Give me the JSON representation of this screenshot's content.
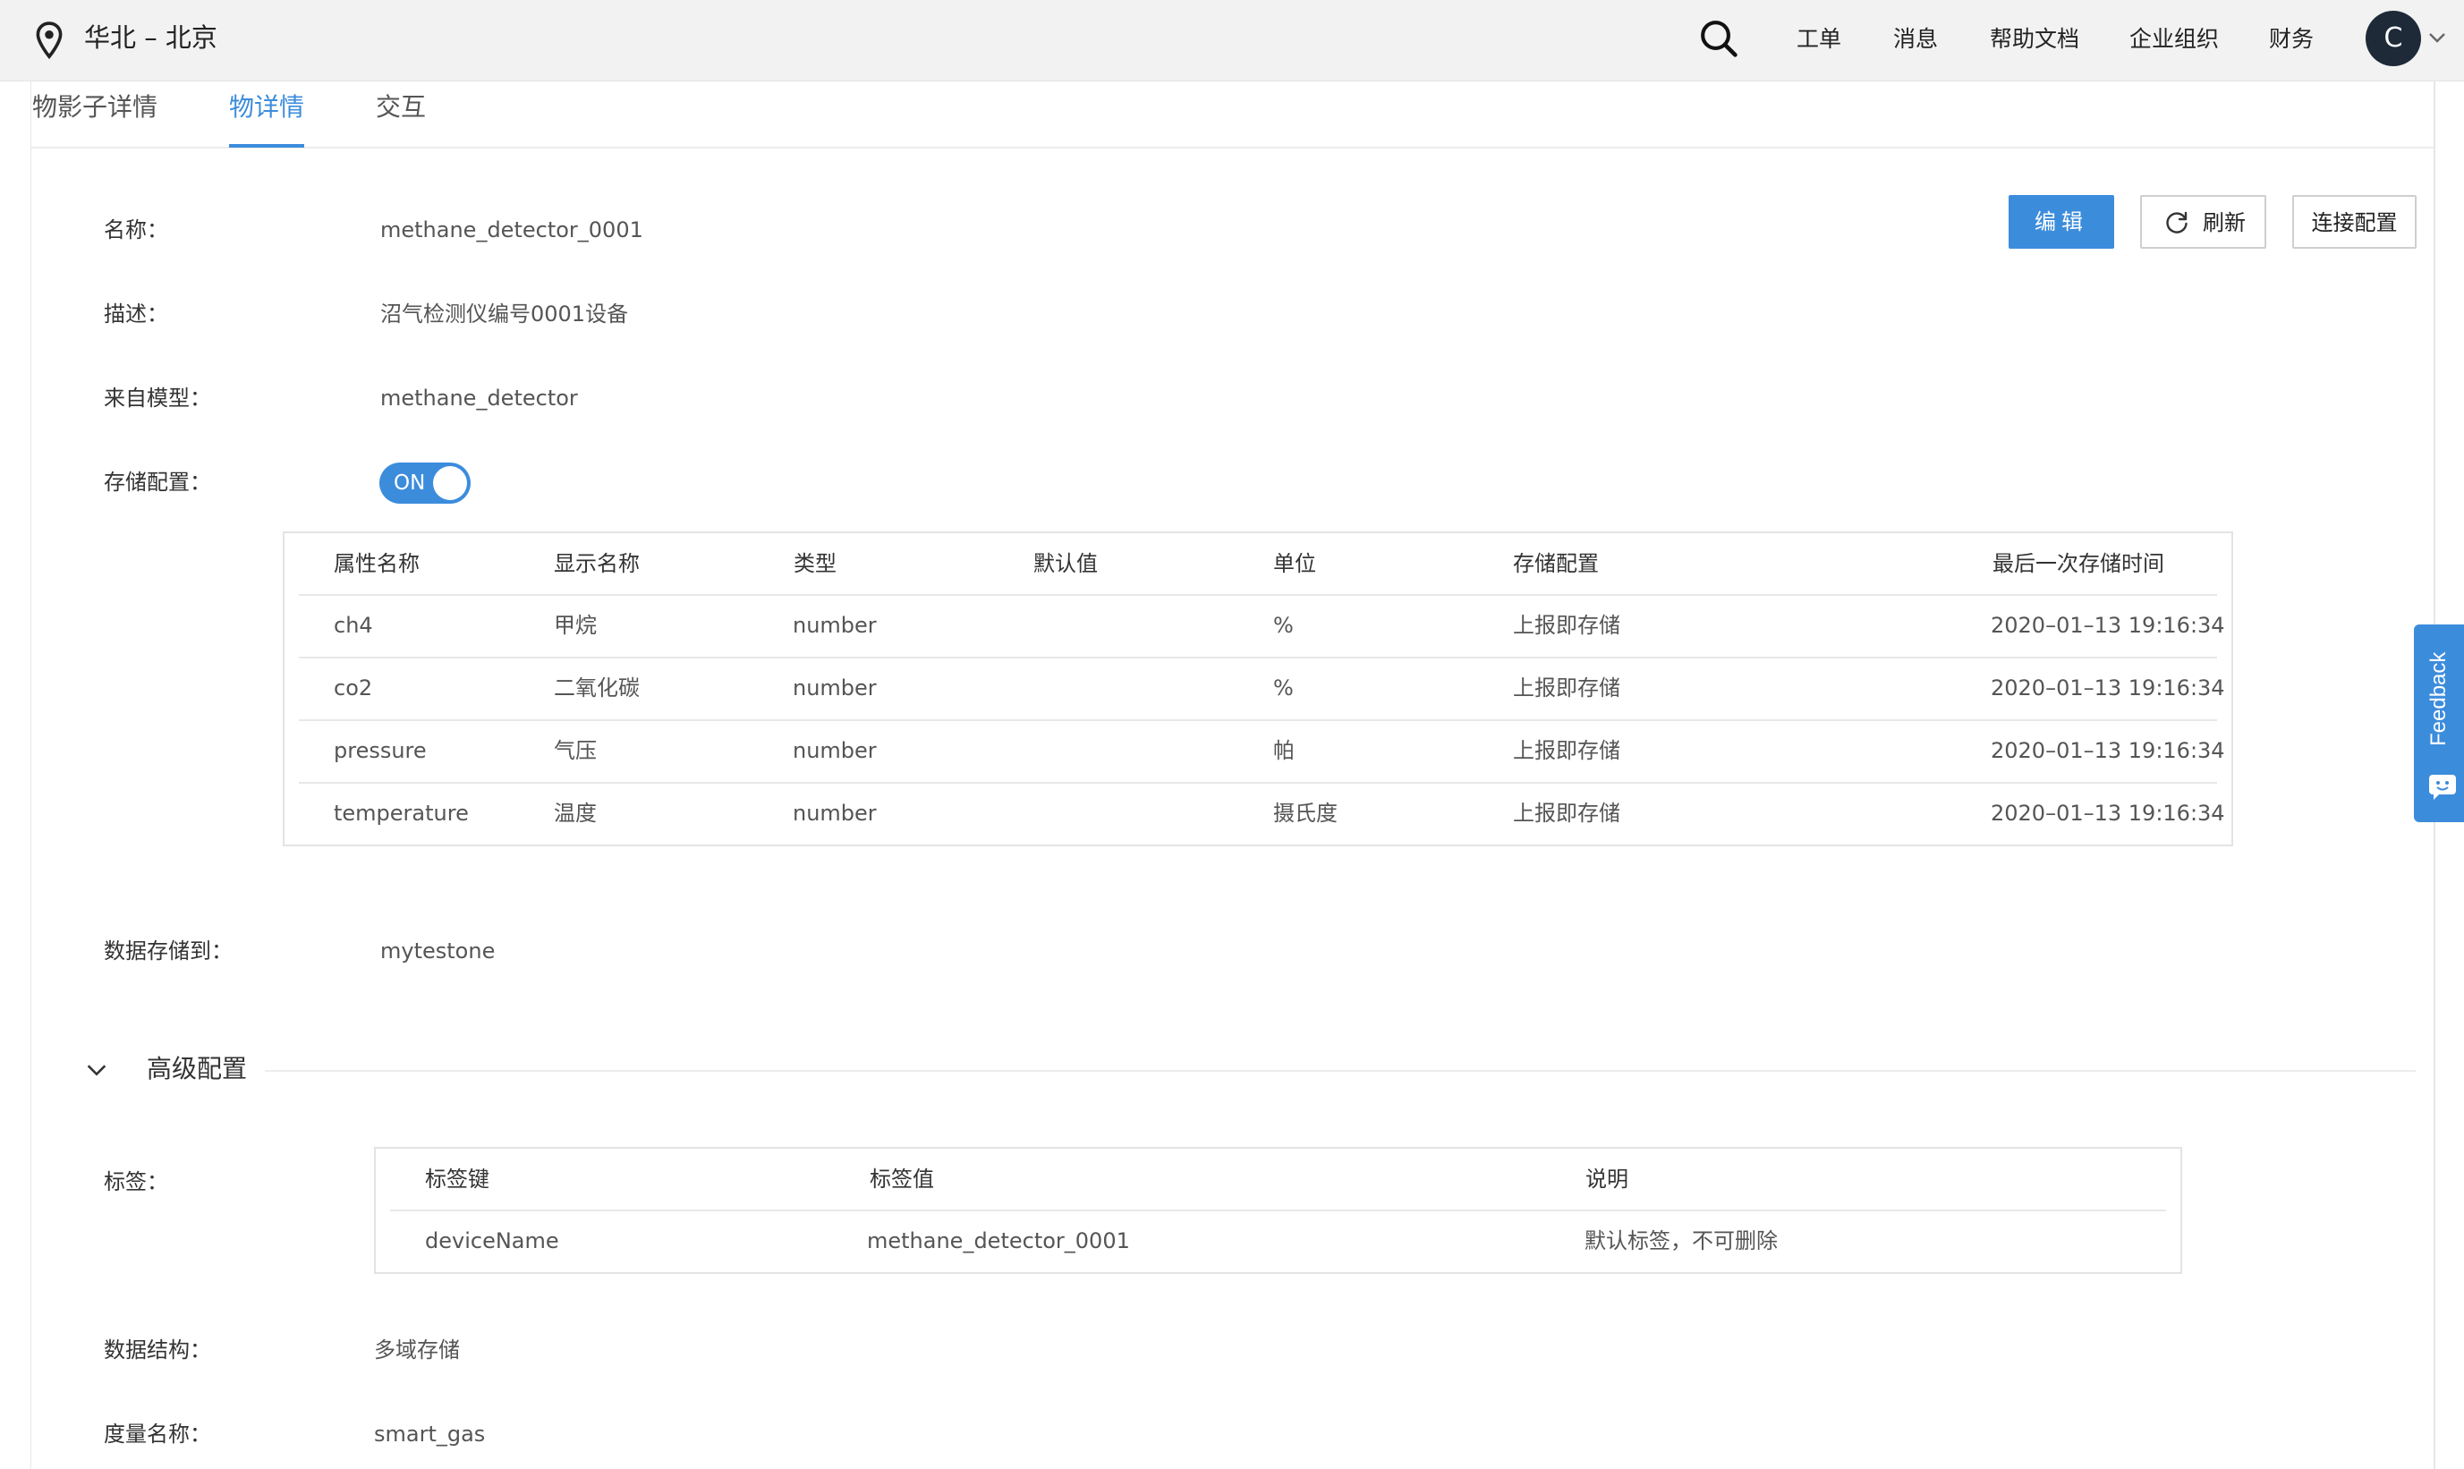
{
  "header": {
    "region": "华北 – 北京",
    "nav": [
      "工单",
      "消息",
      "帮助文档",
      "企业组织",
      "财务"
    ],
    "avatar_letter": "C"
  },
  "tabs": [
    {
      "label": "物影子详情",
      "active": false
    },
    {
      "label": "物详情",
      "active": true
    },
    {
      "label": "交互",
      "active": false
    }
  ],
  "actions": {
    "edit": "编辑",
    "refresh": "刷新",
    "connect": "连接配置"
  },
  "details": {
    "name_label": "名称：",
    "name_value": "methane_detector_0001",
    "desc_label": "描述：",
    "desc_value": "沼气检测仪编号0001设备",
    "model_label": "来自模型：",
    "model_value": "methane_detector",
    "storage_label": "存储配置：",
    "storage_toggle": "ON",
    "store_to_label": "数据存储到：",
    "store_to_value": "mytestone"
  },
  "properties_table": {
    "headers": [
      "属性名称",
      "显示名称",
      "类型",
      "默认值",
      "单位",
      "存储配置",
      "最后一次存储时间"
    ],
    "rows": [
      [
        "ch4",
        "甲烷",
        "number",
        "",
        "%",
        "上报即存储",
        "2020–01–13 19:16:34"
      ],
      [
        "co2",
        "二氧化碳",
        "number",
        "",
        "%",
        "上报即存储",
        "2020–01–13 19:16:34"
      ],
      [
        "pressure",
        "气压",
        "number",
        "",
        "帕",
        "上报即存储",
        "2020–01–13 19:16:34"
      ],
      [
        "temperature",
        "温度",
        "number",
        "",
        "摄氏度",
        "上报即存储",
        "2020–01–13 19:16:34"
      ]
    ]
  },
  "advanced": {
    "title": "高级配置",
    "tags_label": "标签：",
    "tags_table": {
      "headers": [
        "标签键",
        "标签值",
        "说明"
      ],
      "rows": [
        [
          "deviceName",
          "methane_detector_0001",
          "默认标签，不可删除"
        ]
      ]
    },
    "structure_label": "数据结构：",
    "structure_value": "多域存储",
    "metric_label": "度量名称：",
    "metric_value": "smart_gas"
  },
  "feedback": "Feedback",
  "colors": {
    "accent": "#3c8cdc",
    "topbar_bg": "#f2f2f2",
    "avatar_bg": "#1e2a38"
  },
  "icons": [
    "location-pin-icon",
    "search-icon",
    "chevron-down-icon",
    "refresh-icon",
    "feedback-chat-icon"
  ]
}
